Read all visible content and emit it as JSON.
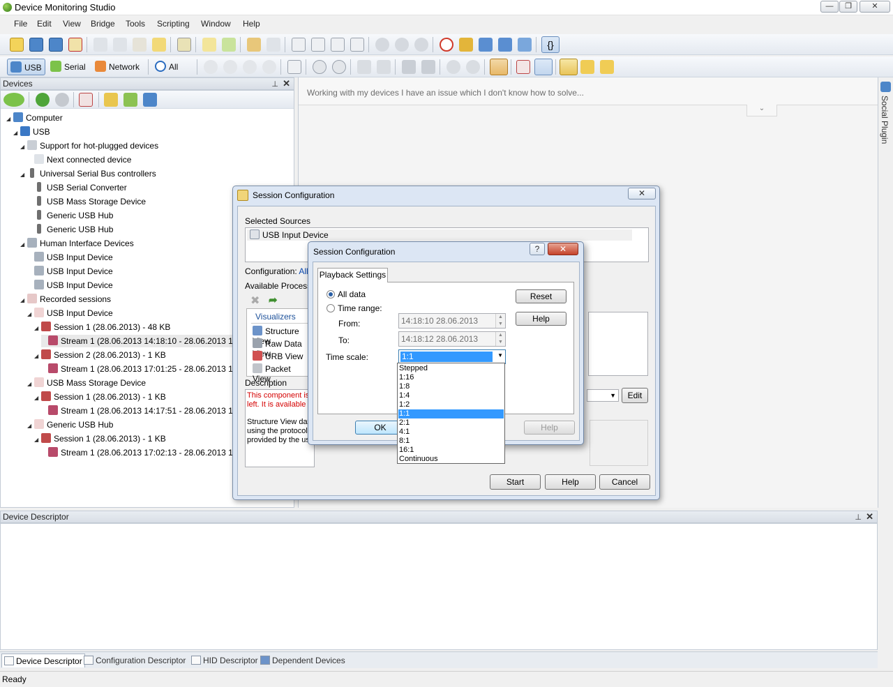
{
  "window": {
    "title": "Device Monitoring Studio",
    "caption_buttons": [
      "minimize",
      "restore",
      "close"
    ]
  },
  "menu": [
    "File",
    "Edit",
    "View",
    "Bridge",
    "Tools",
    "Scripting",
    "Window",
    "Help"
  ],
  "source_toolbar": {
    "usb": "USB",
    "serial": "Serial",
    "network": "Network",
    "all": "All"
  },
  "devices_panel": {
    "title": "Devices",
    "tree": [
      {
        "label": "Computer",
        "level": 0,
        "expanded": true,
        "icon": "computer-icon"
      },
      {
        "label": "USB",
        "level": 1,
        "expanded": true,
        "icon": "usb-icon"
      },
      {
        "label": "Support for hot-plugged devices",
        "level": 2,
        "expanded": true,
        "icon": "hotplug-icon"
      },
      {
        "label": "Next connected device",
        "level": 3,
        "expanded": null,
        "icon": "next-device-icon"
      },
      {
        "label": "Universal Serial Bus controllers",
        "level": 2,
        "expanded": true,
        "icon": "usb-plug-icon"
      },
      {
        "label": "USB Serial Converter",
        "level": 3,
        "expanded": null,
        "icon": "usb-plug-icon"
      },
      {
        "label": "USB Mass Storage Device",
        "level": 3,
        "expanded": null,
        "icon": "usb-plug-icon"
      },
      {
        "label": "Generic USB Hub",
        "level": 3,
        "expanded": null,
        "icon": "usb-plug-icon"
      },
      {
        "label": "Generic USB Hub",
        "level": 3,
        "expanded": null,
        "icon": "usb-plug-icon"
      },
      {
        "label": "Human Interface Devices",
        "level": 2,
        "expanded": true,
        "icon": "hid-icon"
      },
      {
        "label": "USB Input Device",
        "level": 3,
        "expanded": null,
        "icon": "hid-icon"
      },
      {
        "label": "USB Input Device",
        "level": 3,
        "expanded": null,
        "icon": "hid-icon"
      },
      {
        "label": "USB Input Device",
        "level": 3,
        "expanded": null,
        "icon": "hid-icon"
      },
      {
        "label": "Recorded sessions",
        "level": 2,
        "expanded": true,
        "icon": "recorded-sessions-icon"
      },
      {
        "label": "USB Input Device",
        "level": 3,
        "expanded": true,
        "icon": "session-doc-icon"
      },
      {
        "label": "Session 1 (28.06.2013) - 48 KB",
        "level": 4,
        "expanded": true,
        "icon": "session-icon"
      },
      {
        "label": "Stream 1 (28.06.2013 14:18:10 - 28.06.2013 14:",
        "level": 5,
        "expanded": null,
        "icon": "stream-icon",
        "selected": true
      },
      {
        "label": "Session 2 (28.06.2013) - 1 KB",
        "level": 4,
        "expanded": true,
        "icon": "session-icon"
      },
      {
        "label": "Stream 1 (28.06.2013 17:01:25 - 28.06.2013 17:0",
        "level": 5,
        "expanded": null,
        "icon": "stream-icon"
      },
      {
        "label": "USB Mass Storage Device",
        "level": 3,
        "expanded": true,
        "icon": "session-doc-icon"
      },
      {
        "label": "Session 1 (28.06.2013) - 1 KB",
        "level": 4,
        "expanded": true,
        "icon": "session-icon"
      },
      {
        "label": "Stream 1 (28.06.2013 14:17:51 - 28.06.2013 14:",
        "level": 5,
        "expanded": null,
        "icon": "stream-icon"
      },
      {
        "label": "Generic USB Hub",
        "level": 3,
        "expanded": true,
        "icon": "session-doc-icon"
      },
      {
        "label": "Session 1 (28.06.2013) - 1 KB",
        "level": 4,
        "expanded": true,
        "icon": "session-icon"
      },
      {
        "label": "Stream 1 (28.06.2013 17:02:13 - 28.06.2013 17:0",
        "level": 5,
        "expanded": null,
        "icon": "stream-icon"
      }
    ]
  },
  "social": {
    "input_placeholder": "Working with my devices I have an issue which I don't know how to solve...",
    "tab": "Social Plugin"
  },
  "descriptor_panel": {
    "title": "Device Descriptor"
  },
  "bottom_tabs": [
    "Device Descriptor",
    "Configuration Descriptor",
    "HID Descriptor",
    "Dependent Devices"
  ],
  "status": "Ready",
  "session_dialog": {
    "title": "Session Configuration",
    "selected_sources_label": "Selected Sources",
    "source": "USB Input Device",
    "configuration_label": "Configuration:",
    "configuration_value": "All D",
    "available_label": "Available Processing",
    "visualizers_tab": "Visualizers",
    "visualizers": [
      "Structure View",
      "Raw Data View",
      "URB View",
      "Packet View"
    ],
    "description_label": "Description",
    "description_red": [
      "This component is",
      "left. It is available"
    ],
    "description_black": [
      "Structure View dat",
      "using the protocol",
      "provided by the us"
    ],
    "edit_label": "Edit",
    "start_label": "Start",
    "help_label": "Help",
    "cancel_label": "Cancel"
  },
  "playback_dialog": {
    "title": "Session Configuration",
    "tab": "Playback Settings",
    "all_data": "All data",
    "time_range": "Time range:",
    "from_label": "From:",
    "from_value": "14:18:10 28.06.2013",
    "to_label": "To:",
    "to_value": "14:18:12 28.06.2013",
    "time_scale_label": "Time scale:",
    "time_scale_value": "1:1",
    "time_scale_options": [
      "Stepped",
      "1:16",
      "1:8",
      "1:4",
      "1:2",
      "1:1",
      "2:1",
      "4:1",
      "8:1",
      "16:1",
      "Continuous"
    ],
    "reset_label": "Reset",
    "help_label": "Help",
    "ok_label": "OK",
    "help2_label": "Help",
    "help_glyph": "?",
    "close_glyph": "✕"
  }
}
